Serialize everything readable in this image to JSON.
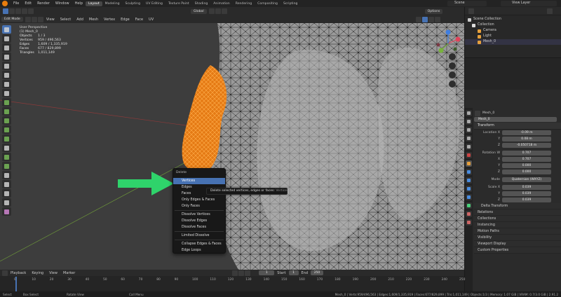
{
  "menus": [
    "File",
    "Edit",
    "Render",
    "Window",
    "Help"
  ],
  "workspaces": [
    "Layout",
    "Modeling",
    "Sculpting",
    "UV Editing",
    "Texture Paint",
    "Shading",
    "Animation",
    "Rendering",
    "Compositing",
    "Scripting"
  ],
  "active_workspace": "Layout",
  "scene": "Scene",
  "view_layer": "View Layer",
  "header": {
    "mode": "Edit Mode",
    "menus": [
      "View",
      "Select",
      "Add",
      "Mesh",
      "Vertex",
      "Edge",
      "Face",
      "UV"
    ],
    "orientation": "Global",
    "options": "Options"
  },
  "overlay": {
    "title": "User Perspective",
    "object": "(1) Mesh_0",
    "stats": [
      {
        "k": "Objects",
        "v": "1 / 3"
      },
      {
        "k": "Vertices",
        "v": "959 / 496,563"
      },
      {
        "k": "Edges",
        "v": "1,609 / 1,335,919"
      },
      {
        "k": "Faces",
        "v": "677 / 829,899"
      },
      {
        "k": "Triangles",
        "v": "1,011,149"
      }
    ]
  },
  "context_menu": {
    "title": "Delete",
    "items": [
      "Vertices",
      "Edges",
      "Faces",
      "Only Edges & Faces",
      "Only Faces",
      "Dissolve Vertices",
      "Dissolve Edges",
      "Dissolve Faces",
      "Limited Dissolve",
      "Collapse Edges & Faces",
      "Edge Loops"
    ],
    "highlighted": "Vertices"
  },
  "tooltip": {
    "text": "Delete selected vertices, edges or faces:",
    "op": "Vertices"
  },
  "outliner": {
    "header": "Scene Collection",
    "items": [
      {
        "label": "Collection",
        "color": "#ccc"
      },
      {
        "label": "Camera",
        "color": "#e6a03c"
      },
      {
        "label": "Light",
        "color": "#e6a03c"
      },
      {
        "label": "Mesh_0",
        "color": "#e6a03c"
      }
    ]
  },
  "properties": {
    "object_name": "Mesh_0",
    "data_name": "Mesh_0",
    "transform_label": "Transform",
    "location_x": "Location X",
    "y_label": "Y",
    "z_label": "Z",
    "rotation_w": "Rotation W",
    "x_label": "X",
    "mode_label": "Mode",
    "scale_x": "Scale X",
    "location": [
      "-0.09 m",
      "0.08 m",
      "-0.050718 m"
    ],
    "rotation": [
      "0.707",
      "0.707",
      "0.000",
      "0.000"
    ],
    "mode": "Quaternion (WXYZ)",
    "scale": [
      "0.039",
      "0.039",
      "0.039"
    ],
    "delta": "Delta Transform",
    "panels": [
      "Relations",
      "Collections",
      "Instancing",
      "Motion Paths",
      "Visibility",
      "Viewport Display",
      "Custom Properties"
    ]
  },
  "timeline": {
    "menus": [
      "Playback",
      "Keying",
      "View",
      "Marker"
    ],
    "current": "1",
    "start_label": "Start",
    "start": "1",
    "end_label": "End",
    "end": "250",
    "ticks": [
      "0",
      "10",
      "20",
      "30",
      "40",
      "50",
      "60",
      "70",
      "80",
      "90",
      "100",
      "110",
      "120",
      "130",
      "140",
      "150",
      "160",
      "170",
      "180",
      "190",
      "200",
      "210",
      "220",
      "230",
      "240",
      "250"
    ]
  },
  "status": {
    "left": [
      "Select",
      "Box Select",
      "Rotate View",
      "Call Menu"
    ],
    "right": "Mesh_0 | Verts:959/496,563 | Edges:1,609/1,335,919 | Faces:677/829,899 | Tris:1,011,149 | Objects:1/3 | Memory: 1.07 GiB | VRAM: 0.7/3.0 GiB | 2.91.2"
  },
  "colors": {
    "accent": "#4772b3",
    "selected": "#ff8c1a",
    "arrow": "#2fd36b"
  }
}
